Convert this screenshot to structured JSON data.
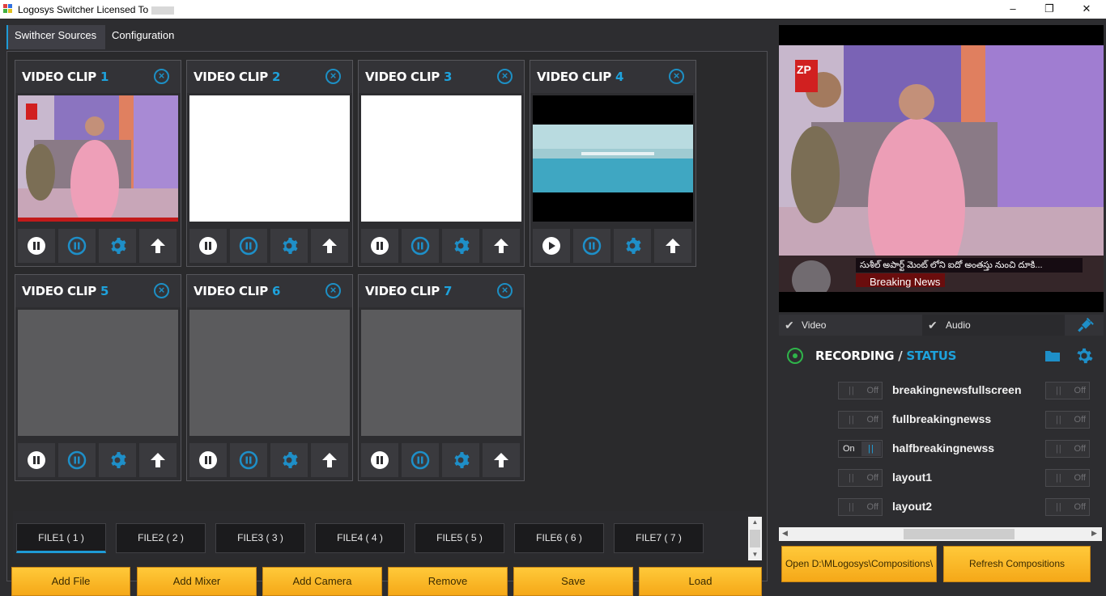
{
  "window": {
    "title": "Logosys Switcher Licensed To",
    "minimize_icon": "minimize-icon",
    "maximize_icon": "restore-icon",
    "close_icon": "close-icon"
  },
  "tabs": [
    {
      "label": "Swithcer Sources",
      "active": true
    },
    {
      "label": "Configuration",
      "active": false
    }
  ],
  "clips": [
    {
      "title": "VIDEO CLIP",
      "number": "1",
      "preview": "image",
      "first_control": "pause-icon"
    },
    {
      "title": "VIDEO CLIP",
      "number": "2",
      "preview": "white",
      "first_control": "pause-icon"
    },
    {
      "title": "VIDEO CLIP",
      "number": "3",
      "preview": "white",
      "first_control": "pause-icon"
    },
    {
      "title": "VIDEO CLIP",
      "number": "4",
      "preview": "video-sea",
      "first_control": "play-icon"
    },
    {
      "title": "VIDEO CLIP",
      "number": "5",
      "preview": "gray",
      "first_control": "pause-icon"
    },
    {
      "title": "VIDEO CLIP",
      "number": "6",
      "preview": "gray",
      "first_control": "pause-icon"
    },
    {
      "title": "VIDEO CLIP",
      "number": "7",
      "preview": "gray",
      "first_control": "pause-icon"
    }
  ],
  "file_tabs": [
    "FILE1 ( 1 )",
    "FILE2 ( 2 )",
    "FILE3 ( 3 )",
    "FILE4 ( 4 )",
    "FILE5 ( 5 )",
    "FILE6 ( 6 )",
    "FILE7 ( 7 )"
  ],
  "actions": [
    "Add File",
    "Add Mixer",
    "Add Camera",
    "Remove",
    "Save",
    "Load"
  ],
  "preview": {
    "ticker_text": "సుశీల్ అపార్ట్ మెంట్ లోని ఐదో అంతస్తు నుంచి దూకి...",
    "breaking_label": "Breaking News",
    "logo_text": "ZP"
  },
  "checks": {
    "video_label": "Video",
    "audio_label": "Audio"
  },
  "recording": {
    "title": "RECORDING",
    "separator": "/",
    "status": "STATUS"
  },
  "compositions": [
    {
      "name": "breakingnewsfullscreen",
      "state": "Off",
      "right_state": "Off"
    },
    {
      "name": "fullbreakingnewss",
      "state": "Off",
      "right_state": "Off"
    },
    {
      "name": "halfbreakingnewss",
      "state": "On",
      "right_state": "Off"
    },
    {
      "name": "layout1",
      "state": "Off",
      "right_state": "Off"
    },
    {
      "name": "layout2",
      "state": "Off",
      "right_state": "Off"
    }
  ],
  "bottom_buttons": {
    "open": "Open D:\\MLogosys\\Compositions\\",
    "refresh": "Refresh Compositions"
  },
  "colors": {
    "accent": "#1e9bd7",
    "orange": "#f7b22a",
    "background": "#2d2d30"
  }
}
